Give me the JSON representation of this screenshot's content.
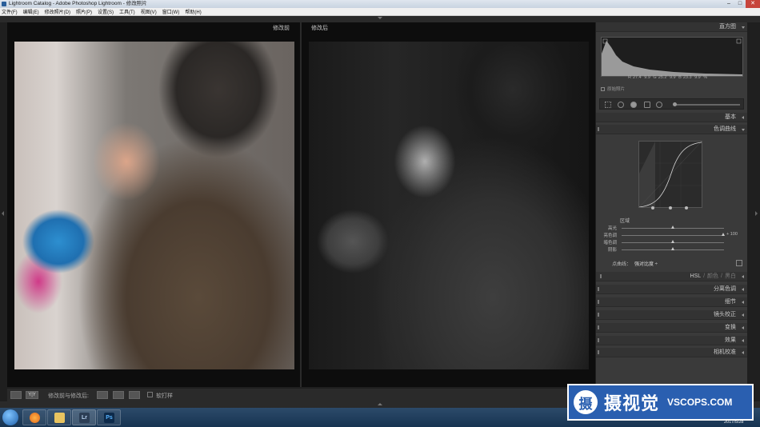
{
  "window": {
    "title": "Lightroom Catalog - Adobe Photoshop Lightroom - 修改照片"
  },
  "menu": [
    "文件(F)",
    "编辑(E)",
    "修改照片(D)",
    "照片(P)",
    "设置(S)",
    "工具(T)",
    "视图(V)",
    "窗口(W)",
    "帮助(H)"
  ],
  "view": {
    "before_label": "修改前",
    "after_label": "修改后"
  },
  "histogram": {
    "title": "直方图",
    "values": [
      {
        "k": "R",
        "v": "27.4"
      },
      {
        "k": "",
        "v": "9.9"
      },
      {
        "k": "G",
        "v": "25.2"
      },
      {
        "k": "",
        "v": "9.9"
      },
      {
        "k": "B",
        "v": "23.3"
      },
      {
        "k": "",
        "v": "9.9"
      },
      {
        "k": "%",
        "v": ""
      }
    ],
    "original_photo_label": "原始照片"
  },
  "panels": {
    "basic": "基本",
    "tone_curve": "色调曲线",
    "hsl": [
      "HSL",
      "/",
      "颜色",
      "/",
      "黑白"
    ],
    "split_toning": "分离色调",
    "detail": "细节",
    "lens_corrections": "镜头校正",
    "transform": "变换",
    "effects": "效果",
    "camera_calibration": "相机校准"
  },
  "tone_curve": {
    "region_label": "区域",
    "sliders": [
      {
        "label": "高光",
        "value": "",
        "fraction": 0.5
      },
      {
        "label": "亮色调",
        "value": "+ 100",
        "fraction": 1.0
      },
      {
        "label": "暗色调",
        "value": "",
        "fraction": 0.5
      },
      {
        "label": "阴影",
        "value": "",
        "fraction": 0.5
      }
    ],
    "point_curve_label": "点曲线：",
    "point_curve_value": "强对比度 ÷"
  },
  "toolbar": {
    "before_after_label": "修改前与修改后:",
    "soft_proof_label": "软打样"
  },
  "taskbar": {
    "apps": [
      "Lr",
      "Ps"
    ],
    "clock": "2017/5/28"
  },
  "watermark": {
    "logo": "摄",
    "cn": "摄视觉",
    "en": "VSCOPS.COM"
  }
}
